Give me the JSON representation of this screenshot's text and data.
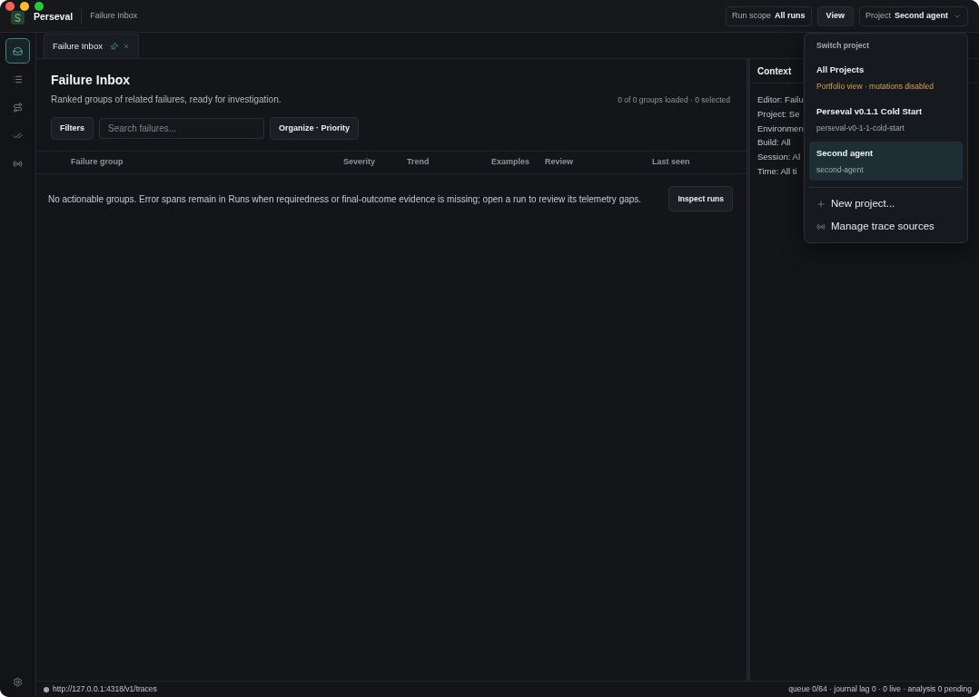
{
  "window": {
    "app_name": "Perseval",
    "breadcrumb": "Failure Inbox"
  },
  "header": {
    "run_scope": {
      "label": "Run scope",
      "value": "All runs"
    },
    "view_button": "View",
    "project": {
      "label": "Project",
      "value": "Second agent",
      "expanded": true
    }
  },
  "sidebar": {
    "items": [
      {
        "selected": true
      },
      {
        "selected": false
      },
      {
        "selected": false
      },
      {
        "selected": false
      },
      {
        "selected": false
      }
    ]
  },
  "tabs": [
    {
      "label": "Failure Inbox",
      "selected": true,
      "pinned": true
    }
  ],
  "inbox": {
    "title": "Failure Inbox",
    "subtitle": "Ranked groups of related failures, ready for investigation.",
    "count": "0 of 0 groups loaded · 0 selected",
    "filters_button": "Filters",
    "search": {
      "placeholder": "Search failures..."
    },
    "organize_button": "Organize · Priority"
  },
  "table": {
    "columns": [
      "Failure group",
      "Severity",
      "Trend",
      "Examples",
      "Review",
      "Last seen"
    ],
    "empty_message": "No actionable groups. Error spans remain in Runs when requiredness or final-outcome evidence is missing; open a run to review its telemetry gaps.",
    "empty_action": "Inspect runs"
  },
  "context": {
    "title": "Context",
    "lines": [
      "Editor: Failu",
      "Project: Se",
      "Environmen",
      "Build: All",
      "Session: Al",
      "Time: All ti"
    ]
  },
  "project_menu": {
    "heading": "Switch project",
    "projects": [
      {
        "name": "All Projects",
        "detail": "Portfolio view · mutations disabled",
        "kind": "portfolio",
        "selected": false
      },
      {
        "name": "Perseval v0.1.1 Cold Start",
        "detail": "perseval-v0-1-1-cold-start",
        "kind": "project",
        "selected": false
      },
      {
        "name": "Second agent",
        "detail": "second-agent",
        "kind": "project",
        "selected": true
      }
    ],
    "actions": [
      "New project...",
      "Manage trace sources"
    ]
  },
  "status_bar": {
    "endpoint": "http://127.0.0.1:4318/v1/traces",
    "summary": "queue 0/64 · journal lag 0 · 0 live · analysis 0 pending"
  }
}
